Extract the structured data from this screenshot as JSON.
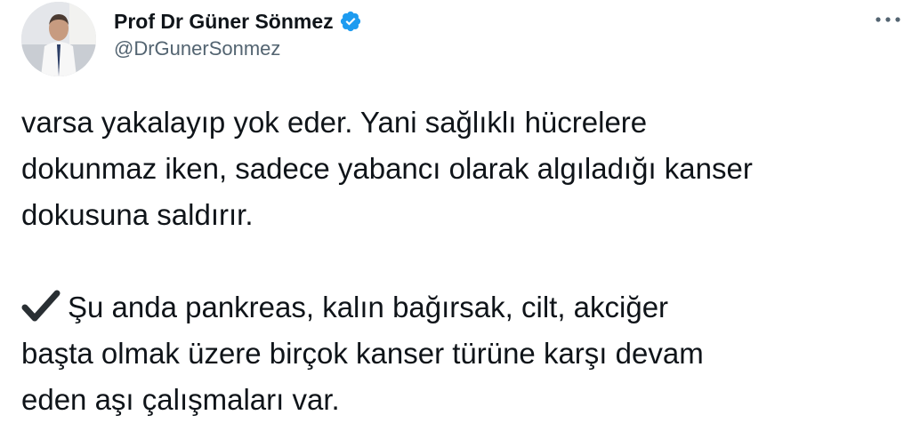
{
  "author": {
    "display_name": "Prof Dr Güner Sönmez",
    "handle": "@DrGunerSonmez",
    "verified": true
  },
  "menu": {
    "more_icon": "ellipsis-icon"
  },
  "tweet": {
    "paragraph1": [
      "varsa yakalayıp yok eder. Yani sağlıklı hücrelere",
      "dokunmaz iken, sadece yabancı olarak algıladığı kanser",
      "dokusuna saldırır."
    ],
    "paragraph2_icon": "heavy-check-mark-icon",
    "paragraph2": [
      "Şu anda pankreas, kalın bağırsak, cilt, akciğer",
      "başta olmak üzere birçok kanser türüne karşı devam",
      "eden aşı çalışmaları var."
    ]
  },
  "colors": {
    "text": "#0f1419",
    "secondary": "#536471",
    "verified_badge": "#1d9bf0"
  }
}
